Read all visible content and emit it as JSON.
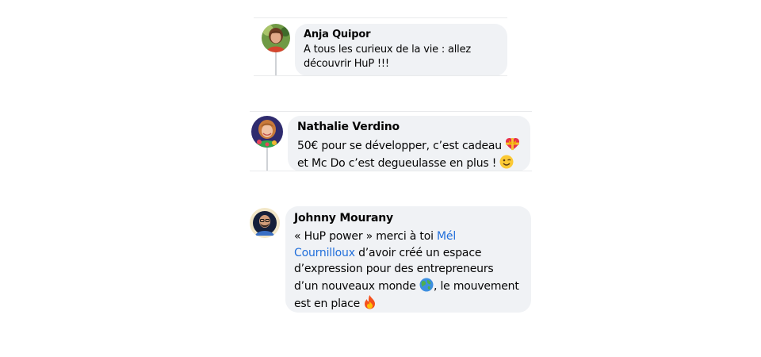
{
  "comments": [
    {
      "author": "Anja Quipor",
      "lines": [
        "A tous les curieux de la vie : allez",
        "découvrir HuP !!!"
      ]
    },
    {
      "author": "Nathalie Verdino",
      "line1": "50€ pour se développer, c’est cadeau",
      "line1_emoji": "heart-with-ribbon-emoji",
      "line2": "et Mc Do c’est degueulasse en plus !",
      "line2_emoji": "winking-face-emoji"
    },
    {
      "author": "Johnny Mourany",
      "line1": "« HuP power » merci à toi",
      "mention_1": "Mél",
      "mention_2": "Cournilloux",
      "line2_rest": "d’avoir créé un espace",
      "line3": "d’expression pour des entrepreneurs",
      "line4_pre": "d’un nouveaux monde",
      "line4_emoji": "globe-emoji",
      "line4_post": ", le mouvement",
      "line5": "est en place",
      "line5_emoji": "fire-emoji"
    }
  ],
  "colors": {
    "bubble_bg": "#f0f2f5",
    "mention": "#216fdb",
    "separator": "#e9eaec",
    "thread_line": "#cfd2d6"
  }
}
